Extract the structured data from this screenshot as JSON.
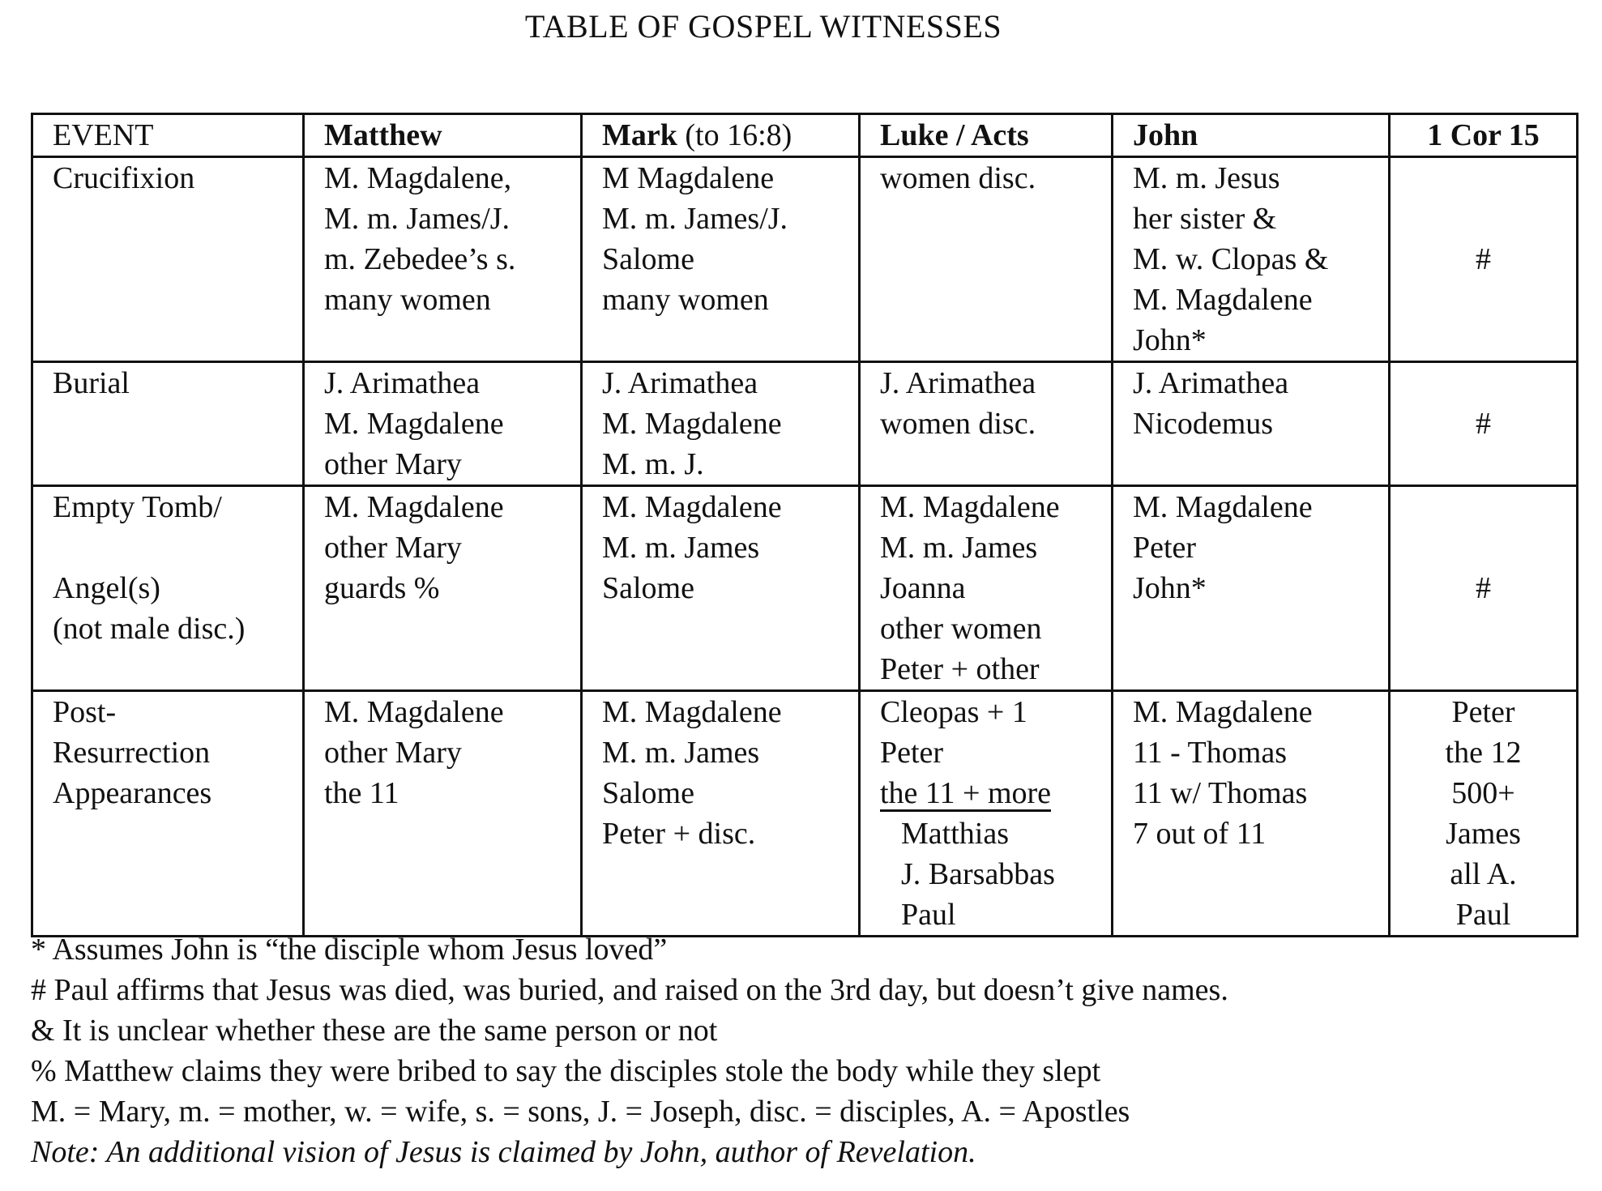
{
  "title": "TABLE OF GOSPEL WITNESSES",
  "table": {
    "headers": [
      {
        "bold": "",
        "normal": "EVENT"
      },
      {
        "bold": "Matthew",
        "normal": ""
      },
      {
        "bold": "Mark",
        "normal": " (to 16:8)"
      },
      {
        "bold": "Luke / Acts",
        "normal": ""
      },
      {
        "bold": "John",
        "normal": ""
      },
      {
        "bold": "1 Cor 15",
        "normal": ""
      }
    ],
    "rows": [
      {
        "event": [
          "Crucifixion"
        ],
        "matthew": [
          "M. Magdalene,",
          "M. m. James/J.",
          "m. Zebedee’s s.",
          "many women"
        ],
        "mark": [
          "M Magdalene",
          "M. m. James/J.",
          "Salome",
          "many women"
        ],
        "luke": [
          "women disc."
        ],
        "john": [
          "M. m. Jesus",
          "her sister &",
          "M. w. Clopas &",
          "M. Magdalene",
          "John*"
        ],
        "cor": [
          "#"
        ]
      },
      {
        "event": [
          "Burial"
        ],
        "matthew": [
          "J. Arimathea",
          "M. Magdalene",
          "other Mary"
        ],
        "mark": [
          "J. Arimathea",
          "M. Magdalene",
          "M. m. J."
        ],
        "luke": [
          "J. Arimathea",
          "women disc."
        ],
        "john": [
          "J. Arimathea",
          "Nicodemus"
        ],
        "cor": [
          "#"
        ]
      },
      {
        "event": [
          "Empty Tomb/",
          "",
          "Angel(s)",
          "(not male disc.)"
        ],
        "matthew": [
          "M. Magdalene",
          "other Mary",
          "guards %"
        ],
        "mark": [
          "M. Magdalene",
          "M. m. James",
          "Salome"
        ],
        "luke": [
          "M. Magdalene",
          "M. m. James",
          "Joanna",
          "other women",
          "Peter + other"
        ],
        "john": [
          "M. Magdalene",
          "Peter",
          "John*"
        ],
        "cor": [
          "#"
        ]
      },
      {
        "event": [
          "Post-",
          "Resurrection",
          "Appearances"
        ],
        "matthew": [
          "M. Magdalene",
          "other Mary",
          "the 11"
        ],
        "mark": [
          "M. Magdalene",
          "M. m. James",
          "Salome",
          "Peter + disc."
        ],
        "luke": [
          "Cleopas + 1",
          "Peter",
          "the 11 + more",
          "Matthias",
          "J. Barsabbas",
          "Paul"
        ],
        "john": [
          "M. Magdalene",
          "11 - Thomas",
          "11 w/ Thomas",
          "7 out of 11"
        ],
        "cor": [
          "Peter",
          "the 12",
          "500+",
          "James",
          "all A.",
          "Paul"
        ]
      }
    ]
  },
  "footnotes": [
    "* Assumes John is “the disciple whom Jesus loved”",
    "# Paul affirms that Jesus was died, was buried, and raised on the 3rd day, but doesn’t give names.",
    "& It is unclear whether these are the same person or not",
    "% Matthew claims they were bribed to say the disciples stole the body while they slept",
    "M. = Mary, m. = mother, w. = wife, s. = sons, J. = Joseph, disc. = disciples, A. = Apostles"
  ],
  "note": "Note: An additional vision of Jesus is claimed by John, author of Revelation."
}
